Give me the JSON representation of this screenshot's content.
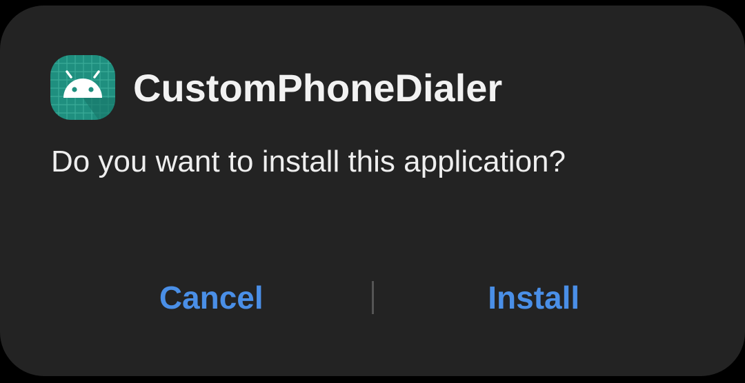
{
  "dialog": {
    "app_name": "CustomPhoneDialer",
    "app_icon": "android-app-icon",
    "message": "Do you want to install this application?",
    "cancel_label": "Cancel",
    "install_label": "Install"
  },
  "colors": {
    "background": "#232323",
    "accent": "#4a8fe7",
    "text": "#f2f2f2",
    "icon_bg": "#1f8f7f"
  }
}
